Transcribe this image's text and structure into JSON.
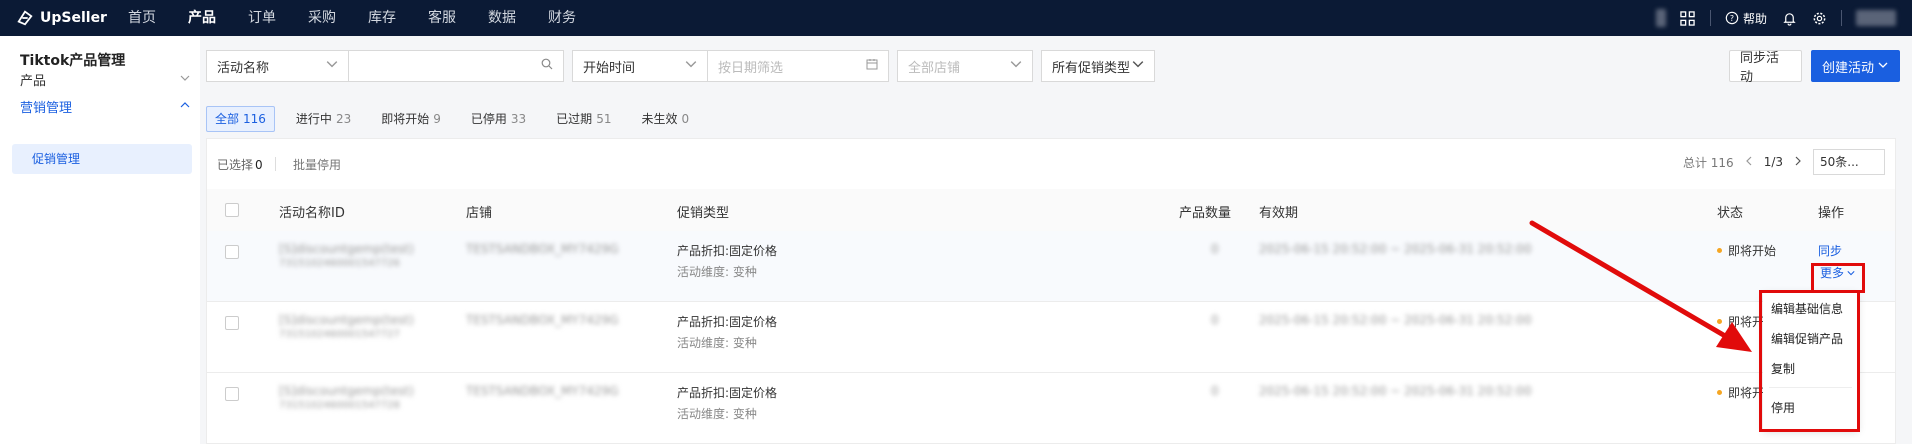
{
  "app": {
    "logo_text": "UpSeller"
  },
  "nav": [
    "首页",
    "产品",
    "订单",
    "采购",
    "库存",
    "客服",
    "数据",
    "财务"
  ],
  "nav_active_index": 1,
  "topbar": {
    "help_label": "帮助"
  },
  "sidebar": {
    "title": "Tiktok产品管理",
    "items": [
      {
        "label": "产品"
      },
      {
        "label": "营销管理"
      }
    ],
    "sub_item": "促销管理"
  },
  "filters": {
    "activity_select": "活动名称",
    "search_placeholder": "",
    "time_select": "开始时间",
    "date_placeholder": "按日期筛选",
    "store_select": "全部店铺",
    "promo_type_select": "所有促销类型"
  },
  "actions": {
    "sync": "同步活动",
    "create": "创建活动"
  },
  "tabs": [
    {
      "label": "全部",
      "count": "116"
    },
    {
      "label": "进行中",
      "count": "23"
    },
    {
      "label": "即将开始",
      "count": "9"
    },
    {
      "label": "已停用",
      "count": "33"
    },
    {
      "label": "已过期",
      "count": "51"
    },
    {
      "label": "未生效",
      "count": "0"
    }
  ],
  "toolbar": {
    "selected_label": "已选择",
    "selected_count": "0",
    "batch_disable": "批量停用",
    "total": "总计 116",
    "page": "1/3",
    "page_size": "50条..."
  },
  "table": {
    "headers": {
      "name": "活动名称ID",
      "store": "店铺",
      "promo_type": "促销类型",
      "qty": "产品数量",
      "validity": "有效期",
      "status": "状态",
      "op": "操作"
    },
    "rows": [
      {
        "name": "[S]discountgemp(test)",
        "id": "7315102460001547726",
        "store": "TESTSANDBOX_MY7429G",
        "promo_type": "产品折扣:固定价格",
        "dim": "活动维度: 变种",
        "qty": "0",
        "validity": "2025-06-15 20:52:00 ~ 2025-06-31 20:52:00",
        "status": "即将开始",
        "op_sync": "同步",
        "op_more": "更多"
      },
      {
        "name": "[S]discountgemp(test)",
        "id": "7315102460001547727",
        "store": "TESTSANDBOX_MY7429G",
        "promo_type": "产品折扣:固定价格",
        "dim": "活动维度: 变种",
        "qty": "0",
        "validity": "2025-06-15 20:52:00 ~ 2025-06-31 20:52:00",
        "status": "即将开始"
      },
      {
        "name": "[S]discountgemp(test)",
        "id": "7315102460001547728",
        "store": "TESTSANDBOX_MY7429G",
        "promo_type": "产品折扣:固定价格",
        "dim": "活动维度: 变种",
        "qty": "0",
        "validity": "2025-06-15 20:52:00 ~ 2025-06-31 20:52:00",
        "status": "即将开始"
      }
    ]
  },
  "more_menu": [
    "编辑基础信息",
    "编辑促销产品",
    "复制",
    "停用"
  ],
  "colors": {
    "brand": "#1a5fe0",
    "annotation": "#e10b0b",
    "topbar": "#0b1a35"
  }
}
